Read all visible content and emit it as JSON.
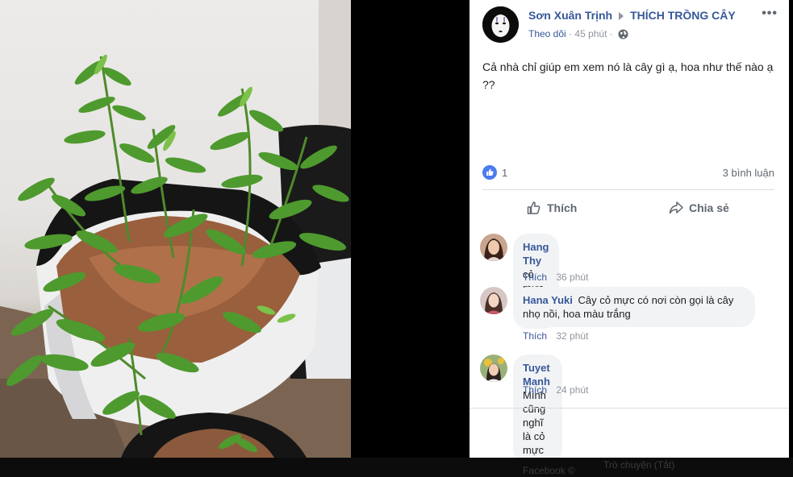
{
  "post": {
    "author": "Sơn Xuân Trịnh",
    "group": "THÍCH TRỒNG CÂY",
    "follow_label": "Theo dõi",
    "separator": "·",
    "time": "45 phút",
    "more_label": "•••",
    "text": "Cả nhà chỉ giúp em xem nó là cây gì ạ, hoa như thế nào ạ ??",
    "like_count": "1",
    "comment_count": "3 bình luận"
  },
  "actions": {
    "like_label": "Thích",
    "share_label": "Chia sẻ"
  },
  "comments": [
    {
      "name": "Hang Thy",
      "text": "cỏ mực đó bạn",
      "like_label": "Thích",
      "time": "36 phút"
    },
    {
      "name": "Hana Yuki",
      "text": "Cây cỏ mực có nơi còn gọi là cây nhọ nồi, hoa màu trắng",
      "like_label": "Thích",
      "time": "32 phút"
    },
    {
      "name": "Tuyet Manh",
      "text": "Mình cũng nghĩ là cỏ mực",
      "like_label": "Thích",
      "time": "24 phút"
    }
  ],
  "bottom": {
    "facebook_label": "Facebook ©",
    "chat_label": "Trò chuyện (Tắt)"
  },
  "colors": {
    "link_blue": "#365899",
    "like_blue": "#4a7bf0",
    "bubble_bg": "#f2f3f5"
  },
  "icons": [
    "no-face-avatar-icon",
    "caret-right-icon",
    "more-options-icon",
    "globe-icon",
    "like-reaction-icon",
    "thumbs-up-icon",
    "share-arrow-icon"
  ]
}
